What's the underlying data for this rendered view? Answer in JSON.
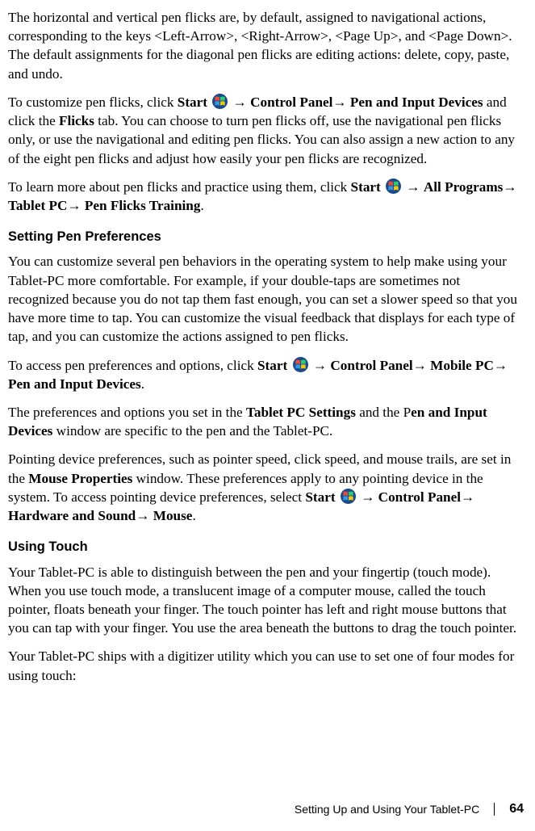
{
  "p1": {
    "a": "The horizontal and vertical pen flicks are, by default, assigned to navigational actions, corresponding to the keys <Left-Arrow>, <Right-Arrow>, <Page Up>, and <Page Down>. The default assignments for the diagonal pen flicks are editing actions: delete, copy, paste, and undo."
  },
  "p2": {
    "a": "To customize pen flicks, click ",
    "start": "Start",
    "b": " ",
    "arrow1": " → ",
    "cp": "Control Panel",
    "arrow2": "→ ",
    "pid": "Pen and Input Devices",
    "c": " and click the ",
    "flicks": "Flicks",
    "d": " tab. You can choose to turn pen flicks off, use the navigational pen flicks only, or use the navigational and editing pen flicks. You can also assign a new action to any of the eight pen flicks and adjust how easily your pen flicks are recognized."
  },
  "p3": {
    "a": "To learn more about pen flicks and practice using them, click ",
    "start": "Start",
    "arrow1": " → ",
    "ap": "All Programs",
    "arrow2": "→ ",
    "tpc": "Tablet PC",
    "arrow3": "→ ",
    "pft": "Pen Flicks Training",
    "dot": "."
  },
  "h1": "Setting Pen Preferences",
  "p4": {
    "a": "You can customize several pen behaviors in the operating system to help make using your Tablet-PC more comfortable. For example, if your double-taps are sometimes not recognized because you do not tap them fast enough, you can set a slower speed so that you have more time to tap. You can customize the visual feedback that displays for each type of tap, and you can customize the actions assigned to pen flicks."
  },
  "p5": {
    "a": "To access pen preferences and options, click ",
    "start": "Start",
    "arrow1": " → ",
    "cp": "Control Panel",
    "arrow2": "→ ",
    "mpc": "Mobile PC",
    "arrow3": "→ ",
    "pid": "Pen and Input Devices",
    "dot": "."
  },
  "p6": {
    "a": "The preferences and options you set in the ",
    "tps": "Tablet PC Settings",
    "b": " and the P",
    "pid": "en and Input Devices",
    "c": " window are specific to the pen and the Tablet-PC."
  },
  "p7": {
    "a": "Pointing device preferences, such as pointer speed, click speed, and mouse trails, are set in the ",
    "mp": "Mouse Properties",
    "b": " window. These preferences apply to any pointing device in the system. To access pointing device preferences, select ",
    "start": "Start",
    "arrow1": " → ",
    "cp": "Control Panel",
    "arrow2": "→ ",
    "hs": "Hardware and Sound",
    "arrow3": "→ ",
    "mouse": "Mouse",
    "dot": "."
  },
  "h2": "Using Touch",
  "p8": {
    "a": "Your Tablet-PC is able to distinguish between the pen and your fingertip (touch mode). When you use touch mode, a translucent image of a computer mouse, called the touch pointer, floats beneath your finger. The touch pointer has left and right mouse buttons that you can tap with your finger. You use the area beneath the buttons to drag the touch pointer."
  },
  "p9": {
    "a": "Your Tablet-PC ships with a digitizer utility which you can use to set one of four modes for using touch:"
  },
  "footer": {
    "title": "Setting Up and Using Your Tablet-PC",
    "page": "64"
  }
}
